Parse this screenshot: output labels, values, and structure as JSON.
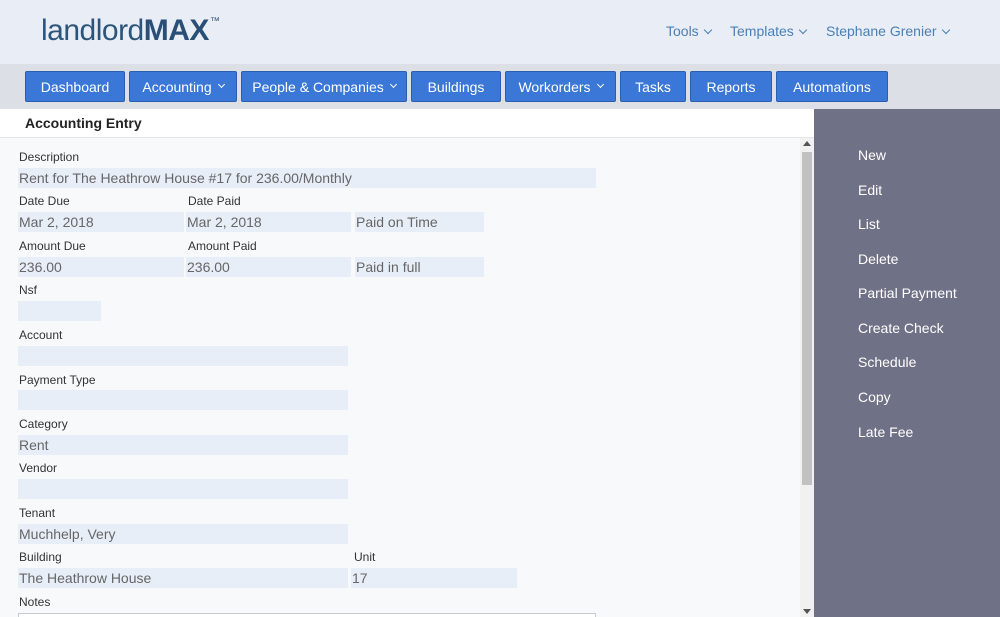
{
  "header": {
    "logo": {
      "light": "landlord",
      "bold": "MAX",
      "tm": "™"
    },
    "menu": [
      {
        "label": "Tools"
      },
      {
        "label": "Templates"
      },
      {
        "label": "Stephane Grenier"
      }
    ]
  },
  "nav": [
    {
      "label": "Dashboard"
    },
    {
      "label": "Accounting"
    },
    {
      "label": "People & Companies"
    },
    {
      "label": "Buildings"
    },
    {
      "label": "Workorders"
    },
    {
      "label": "Tasks"
    },
    {
      "label": "Reports"
    },
    {
      "label": "Automations"
    }
  ],
  "section_title": "Accounting Entry",
  "form": {
    "description": {
      "label": "Description",
      "value": "Rent for The Heathrow House #17 for 236.00/Monthly"
    },
    "date_due": {
      "label": "Date Due",
      "value": "Mar 2, 2018"
    },
    "date_paid": {
      "label": "Date Paid",
      "value": "Mar 2, 2018"
    },
    "paid_status": {
      "value": "Paid on Time"
    },
    "amount_due": {
      "label": "Amount Due",
      "value": "236.00"
    },
    "amount_paid": {
      "label": "Amount Paid",
      "value": "236.00"
    },
    "payment_status": {
      "value": "Paid in full"
    },
    "nsf": {
      "label": "Nsf",
      "value": ""
    },
    "account": {
      "label": "Account",
      "value": ""
    },
    "payment_type": {
      "label": "Payment Type",
      "value": ""
    },
    "category": {
      "label": "Category",
      "value": "Rent"
    },
    "vendor": {
      "label": "Vendor",
      "value": ""
    },
    "tenant": {
      "label": "Tenant",
      "value": "Muchhelp, Very"
    },
    "building": {
      "label": "Building",
      "value": "The Heathrow House"
    },
    "unit": {
      "label": "Unit",
      "value": "17"
    },
    "notes": {
      "label": "Notes",
      "value": ""
    }
  },
  "sidebar": {
    "items": [
      {
        "label": "New"
      },
      {
        "label": "Edit"
      },
      {
        "label": "List"
      },
      {
        "label": "Delete"
      },
      {
        "label": "Partial Payment"
      },
      {
        "label": "Create Check"
      },
      {
        "label": "Schedule"
      },
      {
        "label": "Copy"
      },
      {
        "label": "Late Fee"
      }
    ]
  },
  "colors": {
    "header_bg": "#e8edf6",
    "nav_button": "#3a77d6",
    "sidebar_bg": "#6f7186",
    "field_bg": "#e8eef8"
  }
}
